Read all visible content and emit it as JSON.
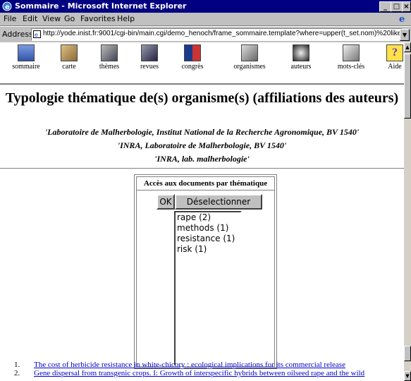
{
  "window": {
    "title": "Sommaire - Microsoft Internet Explorer",
    "controls": [
      "_",
      "□",
      "×"
    ]
  },
  "menu": [
    "File",
    "Edit",
    "View",
    "Go",
    "Favorites",
    "Help"
  ],
  "address": {
    "label": "Address",
    "url": "http://yode.inist.fr:9001/cgi-bin/main.cgi/demo_henoch/frame_sommaire.template?where=upper(t_set.nom)%20like"
  },
  "nav": [
    {
      "label": "sommaire",
      "icon": "sommaire-icon",
      "color": "#5577cc"
    },
    {
      "label": "carte",
      "icon": "carte-icon",
      "color": "#cc9966"
    },
    {
      "label": "thèmes",
      "icon": "themes-icon",
      "color": "#778899"
    },
    {
      "label": "revues",
      "icon": "revues-icon",
      "color": "#556699"
    },
    {
      "label": "congrès",
      "icon": "congres-icon",
      "color": "#3366aa"
    },
    {
      "label": "organismes",
      "icon": "organismes-icon",
      "color": "#888888"
    },
    {
      "label": "auteurs",
      "icon": "auteurs-icon",
      "color": "#444444"
    },
    {
      "label": "mots-clés",
      "icon": "mots-cles-icon",
      "color": "#999999"
    },
    {
      "label": "Aide",
      "icon": "aide-icon",
      "color": "#ddbb00"
    }
  ],
  "page": {
    "title": "Typologie thématique de(s) organisme(s) (affiliations des auteurs)",
    "affiliations": [
      "'Laboratoire de Malherbologie, Institut National de la Recherche Agronomique, BV 1540'",
      "'INRA, Laboratoire de Malherbologie, BV 1540'",
      "'INRA, lab. malherbologie'"
    ]
  },
  "theme_box": {
    "header": "Accès aux documents par thématique",
    "ok_label": "OK",
    "deselect_label": "Déselectionner",
    "items": [
      "rape (2)",
      "methods (1)",
      "resistance (1)",
      "risk (1)"
    ]
  },
  "results": [
    {
      "num": "1.",
      "text": "The cost of herbicide resistance in white-chicory : ecological implications for its commercial release"
    },
    {
      "num": "2.",
      "text": "Gene dispersal from transgenic crops. I: Growth of interspecific hybrids between oilseed rape and the wild"
    }
  ]
}
